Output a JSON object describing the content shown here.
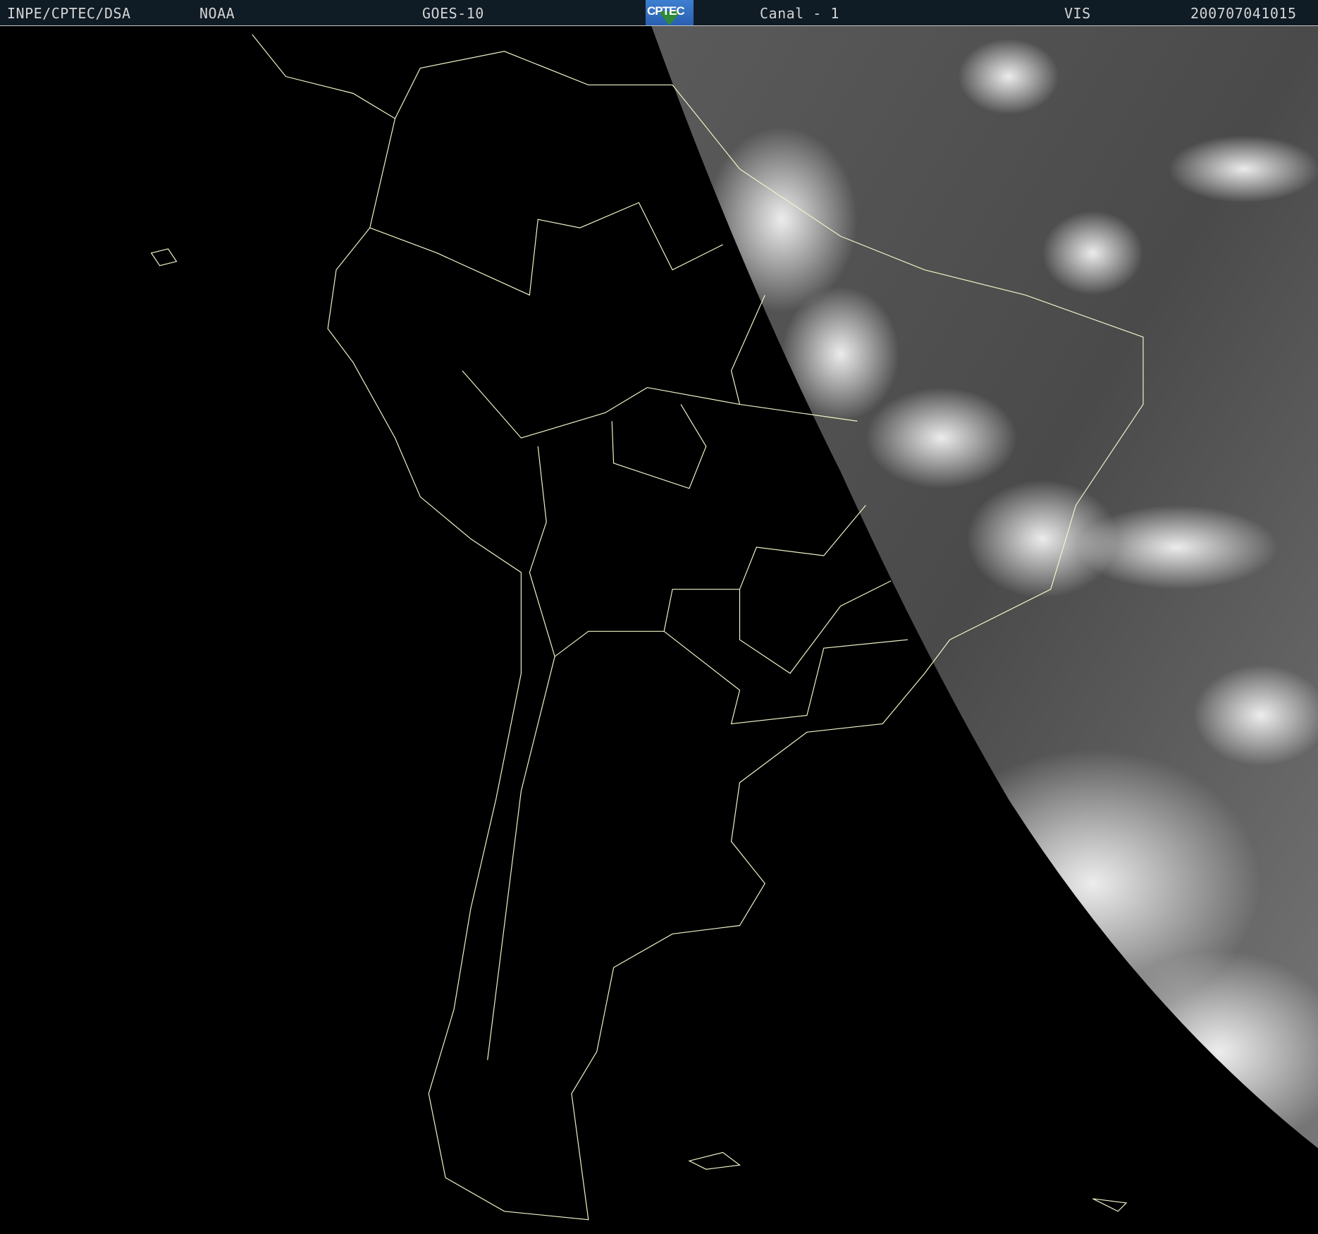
{
  "header": {
    "agency": "INPE/CPTEC/DSA",
    "source": "NOAA",
    "satellite": "GOES-10",
    "logo_text": "CPTEC",
    "channel": "Canal - 1",
    "band": "VIS",
    "timestamp": "200707041015"
  },
  "colors": {
    "header_bg": "#0f1b25",
    "header_text": "#d4d4d4",
    "borders": "#f2f2c8",
    "space": "#000000"
  }
}
